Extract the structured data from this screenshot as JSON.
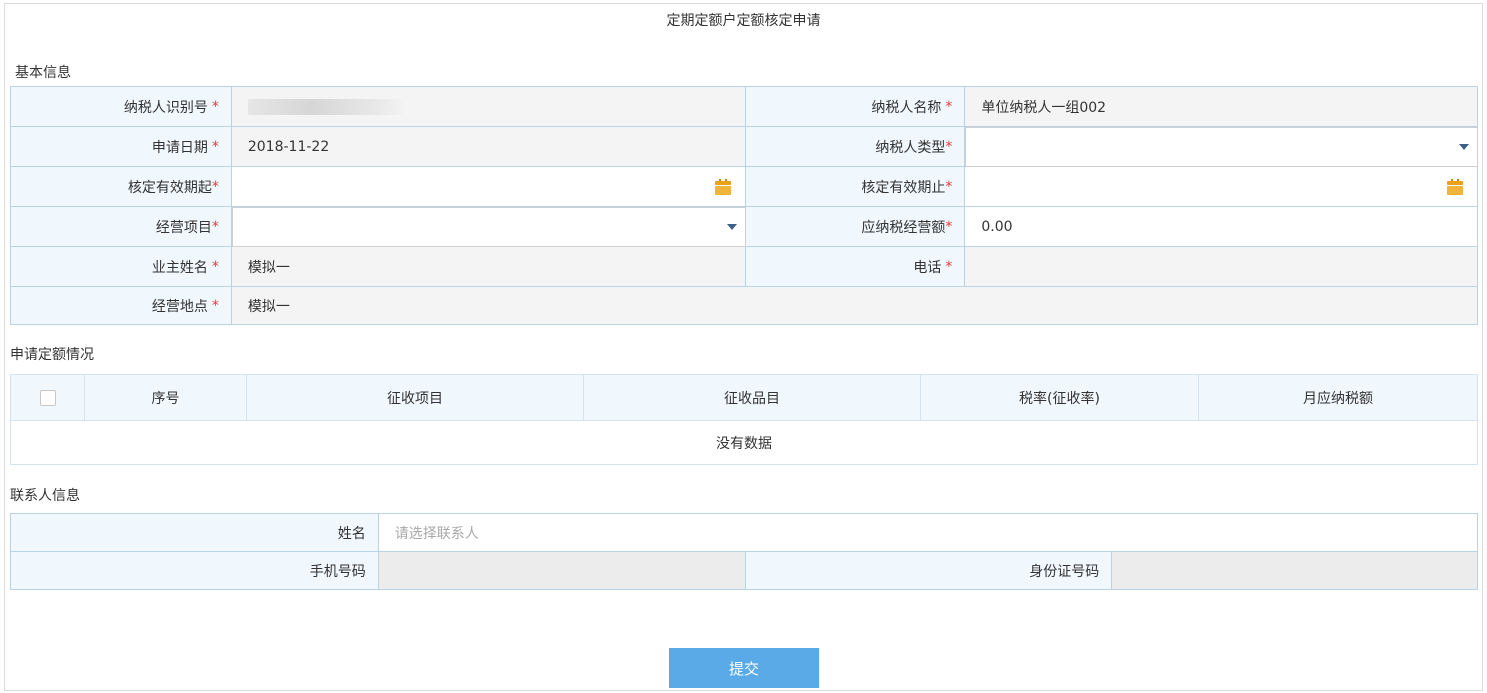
{
  "page": {
    "title": "定期定额户定额核定申请"
  },
  "basic": {
    "section_title": "基本信息",
    "taxpayer_id_label": "纳税人识别号",
    "taxpayer_name_label": "纳税人名称",
    "taxpayer_name_value": "单位纳税人一组002",
    "apply_date_label": "申请日期",
    "apply_date_value": "2018-11-22",
    "taxpayer_type_label": "纳税人类型",
    "valid_from_label": "核定有效期起",
    "valid_to_label": "核定有效期止",
    "business_item_label": "经营项目",
    "taxable_amount_label": "应纳税经营额",
    "taxable_amount_value": "0.00",
    "owner_name_label": "业主姓名",
    "owner_name_value": "模拟一",
    "phone_label": "电话",
    "address_label": "经营地点",
    "address_value": "模拟一",
    "required_mark": "*"
  },
  "quota": {
    "section_title": "申请定额情况",
    "columns": [
      "序号",
      "征收项目",
      "征收品目",
      "税率(征收率)",
      "月应纳税额"
    ],
    "empty_text": "没有数据"
  },
  "contact": {
    "section_title": "联系人信息",
    "name_label": "姓名",
    "name_placeholder": "请选择联系人",
    "mobile_label": "手机号码",
    "id_card_label": "身份证号码"
  },
  "actions": {
    "submit_label": "提交"
  },
  "colors": {
    "label_bg": "#f0f7fd",
    "border": "#b9d3e6",
    "required": "#e83a3a",
    "submit_bg": "#5aaae8",
    "caret": "#3b5f86",
    "calendar": "#f0b43a"
  }
}
